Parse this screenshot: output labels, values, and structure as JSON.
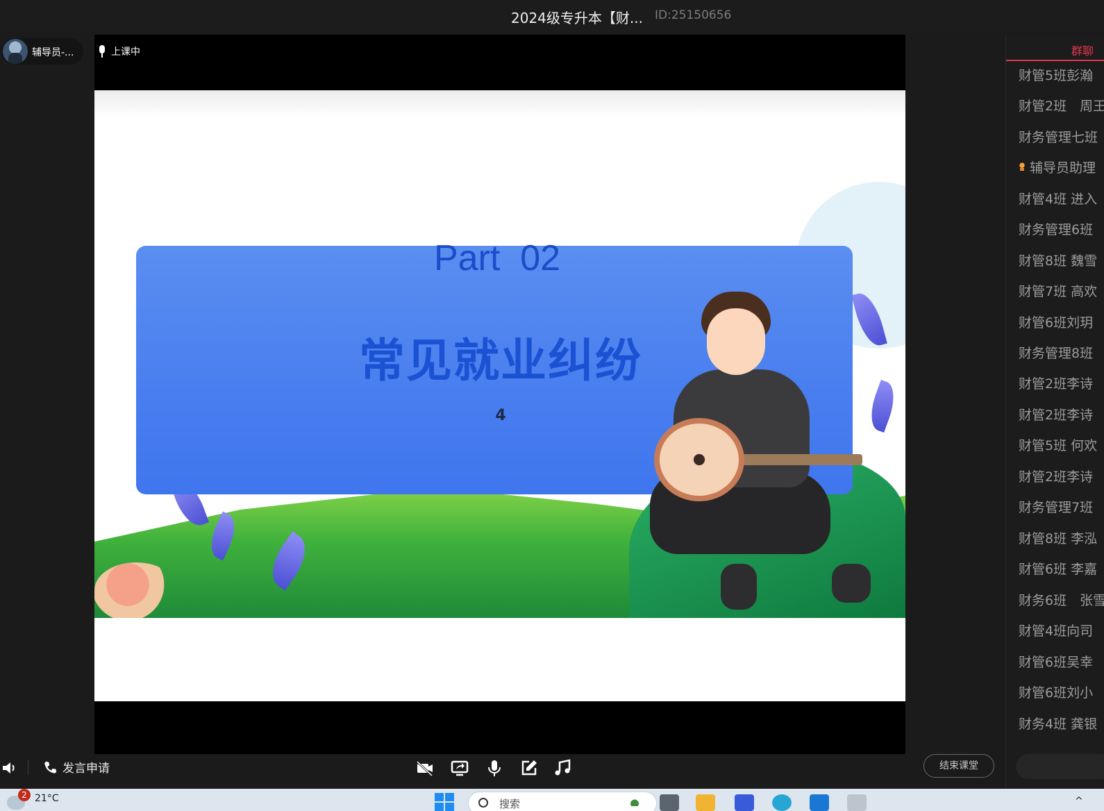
{
  "window": {
    "title": "2024级专升本【财...",
    "room_id": "ID:25150656"
  },
  "host": {
    "name": "辅导员-..."
  },
  "stage": {
    "status": "上课中",
    "slide": {
      "part": "Part  02",
      "title": "常见就业纠纷",
      "page": "4"
    }
  },
  "chat": {
    "tab_label": "群聊",
    "messages": [
      "财管5班彭瀚",
      "财管2班　周王",
      "财务管理七班",
      "辅导员助理",
      "财管4班 进入",
      "财务管理6班",
      "财管8班 魏雪",
      "财管7班 高欢",
      "财管6班刘玥",
      "财务管理8班",
      "财管2班李诗",
      "财管2班李诗",
      "财管5班 何欢",
      "财管2班李诗",
      "财务管理7班",
      "财管8班 李泓",
      "财管6班 李嘉",
      "财务6班　张雪",
      "财管4班向司",
      "财管6班吴幸",
      "财管6班刘小",
      "财务4班 龚银"
    ]
  },
  "controls": {
    "speak_request": "发言申请",
    "end_class": "结束课堂",
    "tools": [
      "camera-off-icon",
      "screen-share-icon",
      "microphone-icon",
      "edit-icon",
      "music-icon"
    ]
  },
  "taskbar": {
    "notification_count": "2",
    "weather": "21°C",
    "search_placeholder": "搜索"
  },
  "colors": {
    "accent": "#e0384d",
    "card_blue": "#4a7fef",
    "title_blue": "#1a52d3"
  }
}
